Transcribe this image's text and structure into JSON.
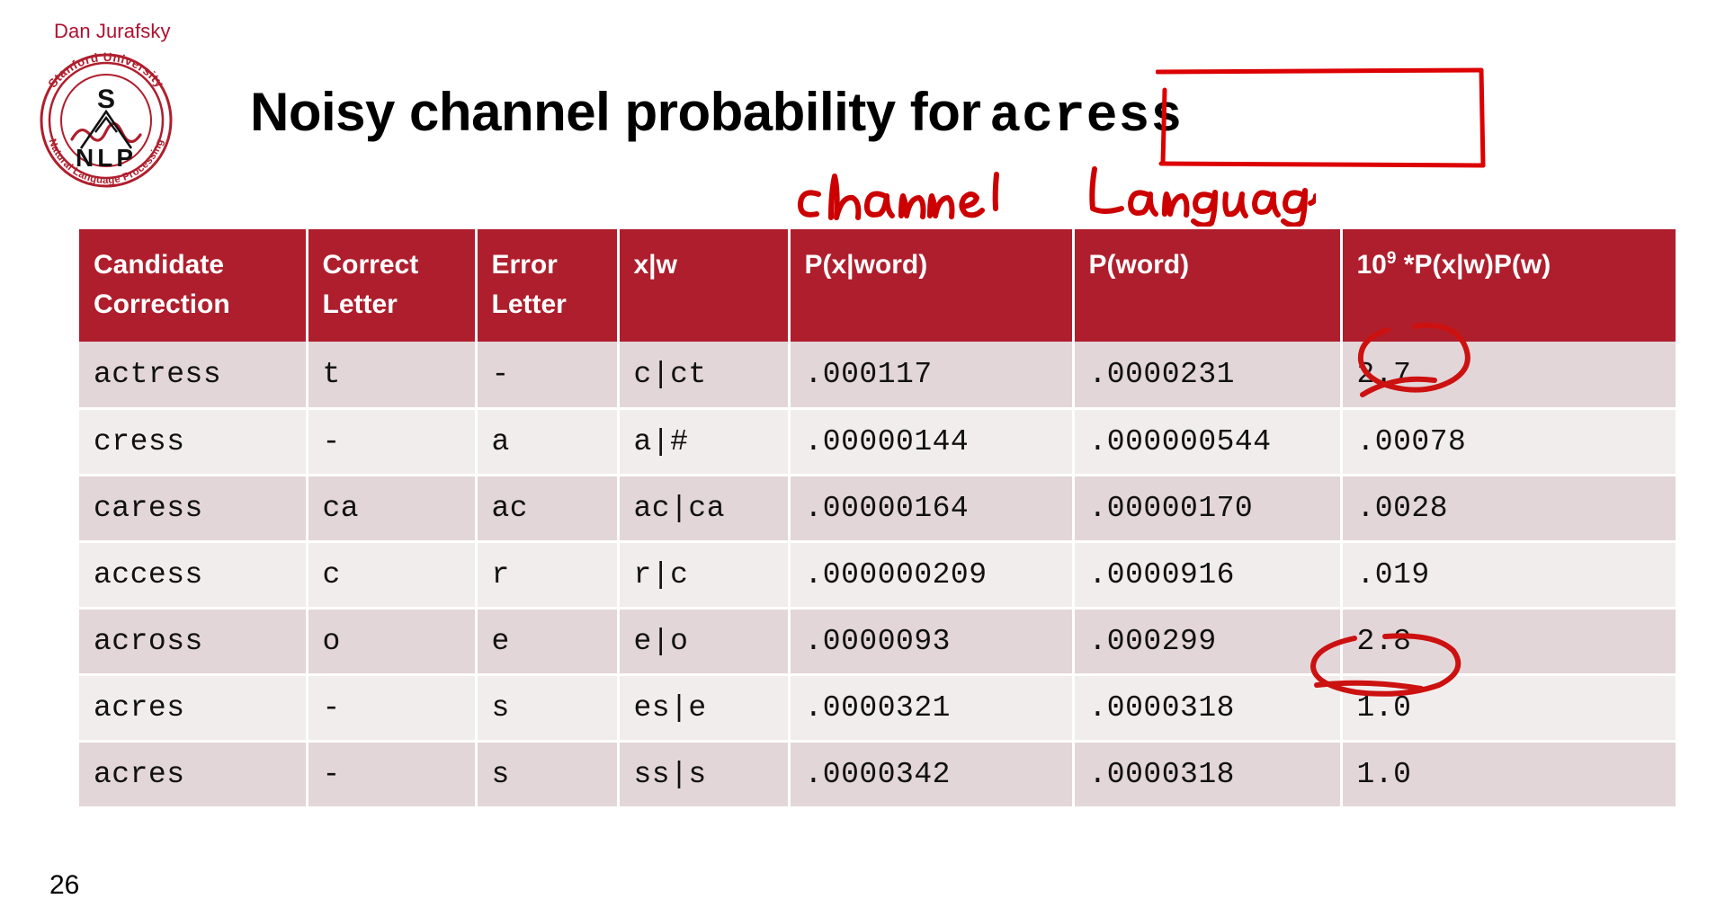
{
  "slide": {
    "author": "Dan Jurafsky",
    "title_prefix": "Noisy channel probability for",
    "title_highlight": "acress",
    "slide_number": "26",
    "logo": {
      "name": "stanford-nlp-logo",
      "outer_text_top": "Stanford University",
      "outer_text_bottom": "Natural Language Processing",
      "letter_top": "S",
      "letters_bottom": "N L P"
    },
    "annotations": [
      {
        "name": "channel-annotation",
        "text": "Channel"
      },
      {
        "name": "language-annotation",
        "text": "Language"
      },
      {
        "name": "circle-annotation-actress",
        "text": ""
      },
      {
        "name": "circle-annotation-across",
        "text": ""
      },
      {
        "name": "acress-box-annotation",
        "text": ""
      }
    ],
    "colors": {
      "brand_red": "#AF1E2D",
      "author_red": "#B01030",
      "ink_red": "#CC0000",
      "row_odd": "#E3D6D8",
      "row_even": "#F2EDED",
      "text": "#111111"
    }
  },
  "chart_data": {
    "type": "table",
    "title": "Noisy channel probability for acress",
    "columns": [
      "Candidate\nCorrection",
      "Correct\nLetter",
      "Error\nLetter",
      "x|w",
      "P(x|word)",
      "P(word)",
      "10^9 *P(x|w)P(w)"
    ],
    "headers": [
      {
        "line1": "Candidate",
        "line2": "Correction"
      },
      {
        "line1": "Correct",
        "line2": "Letter"
      },
      {
        "line1": "Error",
        "line2": "Letter"
      },
      {
        "line1": "x|w",
        "line2": ""
      },
      {
        "line1": "P(x|word)",
        "line2": ""
      },
      {
        "line1": "P(word)",
        "line2": ""
      },
      {
        "line1_pre": "10",
        "line1_sup": "9",
        "line1_post": " *P(x|w)P(w)",
        "line2": ""
      }
    ],
    "rows": [
      {
        "candidate": "actress",
        "correct_letter": "t",
        "error_letter": "-",
        "xw": "c|ct",
        "p_x_word": ".000117",
        "p_word": ".0000231",
        "score": "2.7"
      },
      {
        "candidate": "cress",
        "correct_letter": "-",
        "error_letter": "a",
        "xw": "a|#",
        "p_x_word": ".00000144",
        "p_word": ".000000544",
        "score": ".00078"
      },
      {
        "candidate": "caress",
        "correct_letter": "ca",
        "error_letter": "ac",
        "xw": "ac|ca",
        "p_x_word": ".00000164",
        "p_word": ".00000170",
        "score": ".0028"
      },
      {
        "candidate": "access",
        "correct_letter": "c",
        "error_letter": "r",
        "xw": "r|c",
        "p_x_word": ".000000209",
        "p_word": ".0000916",
        "score": ".019"
      },
      {
        "candidate": "across",
        "correct_letter": "o",
        "error_letter": "e",
        "xw": "e|o",
        "p_x_word": ".0000093",
        "p_word": ".000299",
        "score": "2.8"
      },
      {
        "candidate": "acres",
        "correct_letter": "-",
        "error_letter": "s",
        "xw": "es|e",
        "p_x_word": ".0000321",
        "p_word": ".0000318",
        "score": "1.0"
      },
      {
        "candidate": "acres",
        "correct_letter": "-",
        "error_letter": "s",
        "xw": "ss|s",
        "p_x_word": ".0000342",
        "p_word": ".0000318",
        "score": "1.0"
      }
    ],
    "highlighted_scores": [
      "2.7",
      "2.8"
    ],
    "xlabel": "",
    "ylabel": "",
    "grid": false,
    "legend": "none"
  }
}
